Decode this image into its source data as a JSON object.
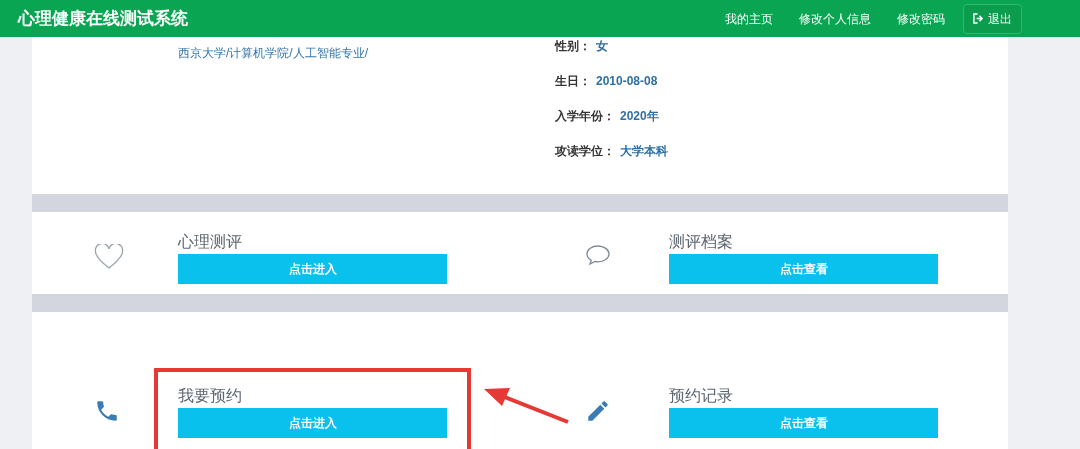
{
  "navbar": {
    "title": "心理健康在线测试系统",
    "links": [
      {
        "label": "我的主页",
        "kind": "link"
      },
      {
        "label": "修改个人信息",
        "kind": "link"
      },
      {
        "label": "修改密码",
        "kind": "link"
      },
      {
        "label": "退出",
        "kind": "logout"
      }
    ]
  },
  "profile": {
    "school": "西京大学/计算机学院/人工智能专业/",
    "fields": [
      {
        "label": "性别：",
        "value": "女"
      },
      {
        "label": "生日：",
        "value": "2010-08-08"
      },
      {
        "label": "入学年份：",
        "value": "2020年"
      },
      {
        "label": "攻读学位：",
        "value": "大学本科"
      }
    ]
  },
  "modules": [
    [
      {
        "kind": "heart",
        "title": "心理测评",
        "button": "点击进入",
        "highlighted": false
      },
      {
        "kind": "chat",
        "title": "测评档案",
        "button": "点击查看",
        "highlighted": false
      }
    ],
    [
      {
        "kind": "phone",
        "title": "我要预约",
        "button": "点击进入",
        "highlighted": true
      },
      {
        "kind": "pencil",
        "title": "预约记录",
        "button": "点击查看",
        "highlighted": false
      }
    ]
  ]
}
